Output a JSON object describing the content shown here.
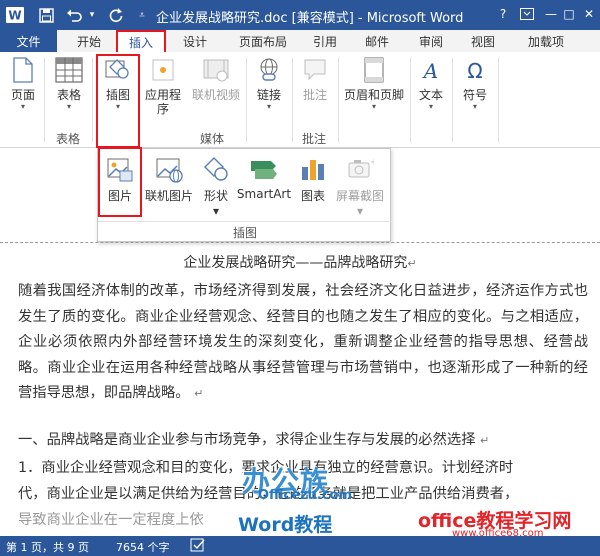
{
  "titlebar": {
    "title": "企业发展战略研究.doc [兼容模式] - Microsoft Word",
    "help": "?",
    "minimize": "—",
    "maximize": "□",
    "close": "✕"
  },
  "tabs": {
    "file": "文件",
    "items": [
      "开始",
      "插入",
      "设计",
      "页面布局",
      "引用",
      "邮件",
      "审阅",
      "视图",
      "加载项"
    ],
    "active": "插入"
  },
  "ribbon": {
    "page": "页面",
    "table": "表格",
    "illustrations": "插图",
    "apps": [
      "应用程",
      "序"
    ],
    "online_video": "联机视频",
    "link": "链接",
    "comment": "批注",
    "header_footer": "页眉和页脚",
    "text": "文本",
    "symbol": "符号",
    "groups": {
      "table": "表格",
      "media": "媒体",
      "comments": "批注"
    }
  },
  "dropdown": {
    "picture": "图片",
    "online_picture": "联机图片",
    "shapes": "形状",
    "smartart": "SmartArt",
    "chart": "图表",
    "screenshot": "屏幕截图",
    "group_label": "插图"
  },
  "document": {
    "title": "企业发展战略研究——品牌战略研究",
    "paragraph1": "随着我国经济体制的改革，市场经济得到发展，社会经济文化日益进步，经济运作方式也发生了质的变化。商业企业经营观念、经营目的也随之发生了相应的变化。与之相适应，企业必须依照内外部经营环境发生的深刻变化，重新调整企业经营的指导思想、经营战略。商业企业在运用各种经营战略从事经营管理与市场营销中，也逐渐形成了一种新的经营指导思想，即品牌战略。",
    "heading1": "一、品牌战略是商业企业参与市场竞争，求得企业生存与发展的必然选择",
    "item1": "1．商业企业经营观念和目的变化，要求企业具有独立的经营意识。计划经济时",
    "item1_cont": "代，商业企业是以满足供给为经营目的，它的任务就是把工业产品供给消费者，",
    "item1_cont2": "导致商业企业在一定程度上依"
  },
  "watermarks": {
    "brand": "办公族",
    "brand_url": "Officezu.com",
    "tutorial": "Word教程",
    "site": "office教程学习网",
    "site_url": "www.office68.com"
  },
  "statusbar": {
    "page": "第 1 页，共 9 页",
    "words": "7654 个字"
  },
  "colors": {
    "brand": "#2b579a",
    "highlight": "#e8161e"
  }
}
